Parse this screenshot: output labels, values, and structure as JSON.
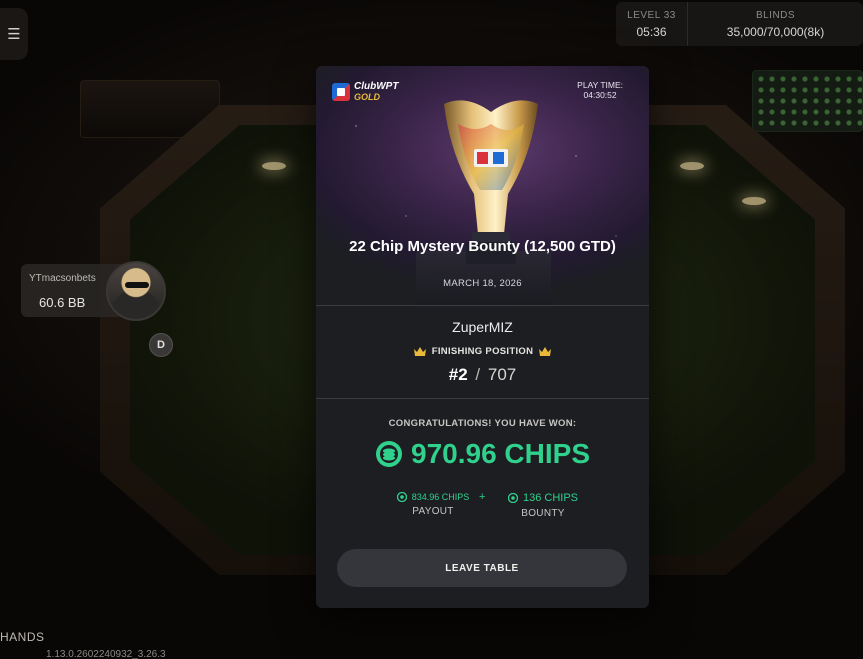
{
  "header": {
    "menu_icon": "hamburger-icon",
    "level_label": "LEVEL 33",
    "level_timer": "05:36",
    "blinds_label": "BLINDS",
    "blinds_value": "35,000/70,000(8k)"
  },
  "seat": {
    "player_name": "YTmacsonbets",
    "stack": "60.6 BB",
    "dealer_button": "D"
  },
  "footer": {
    "hands_label": "HANDS",
    "build_text": "1.13.0.2602240932_3.26.3"
  },
  "modal": {
    "brand_line1": "ClubWPT",
    "brand_line2": "GOLD",
    "play_time_label": "PLAY TIME:",
    "play_time_value": "04:30:52",
    "event_title": "22 Chip Mystery Bounty (12,500 GTD)",
    "event_date": "MARCH 18, 2026",
    "username": "ZuperMIZ",
    "finishing_label": "FINISHING POSITION",
    "place": "#2",
    "separator": "/",
    "total_players": "707",
    "congrats_text": "CONGRATULATIONS! YOU HAVE WON:",
    "won_amount": "970.96 CHIPS",
    "payout_value": "834.96 CHIPS",
    "payout_label": "PAYOUT",
    "plus_sign": "+",
    "bounty_value": "136 CHIPS",
    "bounty_label": "BOUNTY",
    "leave_button": "LEAVE TABLE"
  },
  "colors": {
    "accent_green": "#2fd18d",
    "modal_bg": "#1c1e22",
    "brand_gold": "#e8b93a"
  }
}
